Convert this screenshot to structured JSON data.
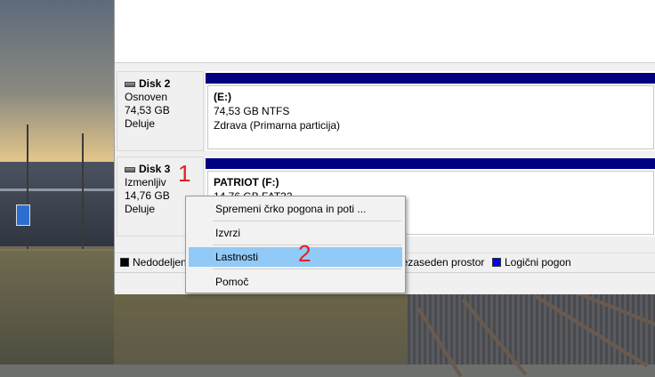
{
  "disks": [
    {
      "name": "Disk 2",
      "type": "Osnoven",
      "size": "74,53 GB",
      "status": "Deluje",
      "partition": {
        "title": "(E:)",
        "detail": "74,53 GB NTFS",
        "health": "Zdrava (Primarna particija)"
      }
    },
    {
      "name": "Disk 3",
      "type": "Izmenljiv",
      "size": "14,76 GB",
      "status": "Deluje",
      "partition": {
        "title": "PATRIOT  (F:)",
        "detail": "14,76 GB FAT32"
      }
    }
  ],
  "legend": [
    {
      "label": "Nedodeljen",
      "color": "#000000"
    },
    {
      "label": "Nezaseden prostor",
      "color": "#000000"
    },
    {
      "label": "Logični pogon",
      "color": "#0000ff"
    }
  ],
  "context_menu": {
    "items": [
      {
        "label": "Spremeni črko pogona in poti ...",
        "highlighted": false
      },
      {
        "label": "Izvrzi",
        "highlighted": false
      },
      {
        "label": "Lastnosti",
        "highlighted": true
      },
      {
        "label": "Pomoč",
        "highlighted": false
      }
    ]
  },
  "annotations": {
    "step1": "1",
    "step2": "2",
    "color": "#e02020"
  },
  "colors": {
    "partition_bar": "#000080",
    "menu_highlight": "#91c9f7"
  }
}
